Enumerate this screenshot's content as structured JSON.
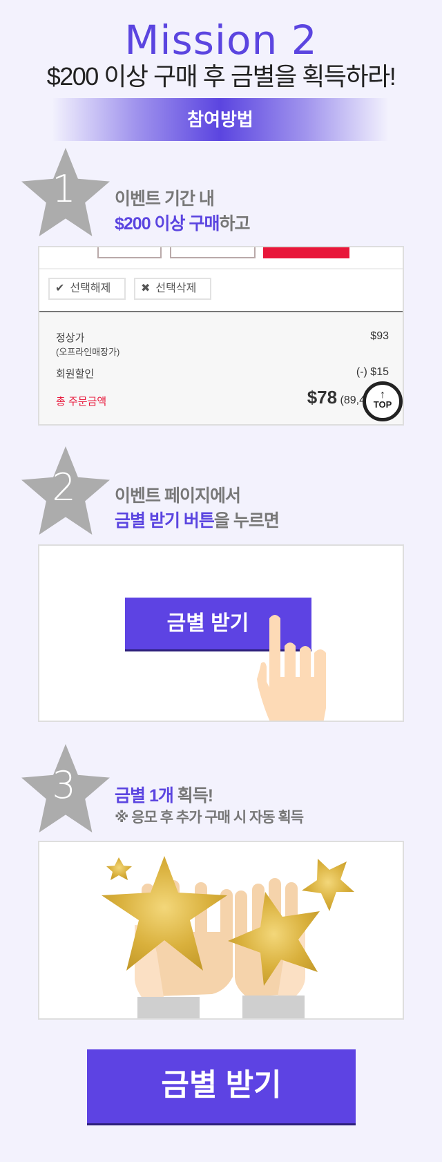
{
  "header": {
    "title": "Mission 2",
    "subtitle": "$200 이상 구매 후 금별을 획득하라!",
    "banner": "참여방법"
  },
  "steps": [
    {
      "number": "1",
      "line1": "이벤트 기간 내",
      "line2_highlight": "$200 이상 구매",
      "line2_rest": "하고"
    },
    {
      "number": "2",
      "line1": "이벤트 페이지에서",
      "line2_highlight": "금별 받기 버튼",
      "line2_rest": "을 누르면"
    },
    {
      "number": "3",
      "line1_highlight": "금별 1개",
      "line1_rest": " 획득!",
      "line2": "※ 응모 후 추가 구매 시 자동 획득"
    }
  ],
  "cart": {
    "deselect": "선택해제",
    "delete_selected": "선택삭제",
    "regular_price_label": "정상가",
    "regular_price_sub": "(오프라인매장가)",
    "regular_price": "$93",
    "member_discount_label": "회원할인",
    "member_discount": "(-) $15",
    "total_label": "총 주문금액",
    "total": "$78",
    "total_sub": "(89,4",
    "top_label": "TOP"
  },
  "demo_button": "금별 받기",
  "cta_button": "금별 받기",
  "colors": {
    "accent": "#5b45e0",
    "red": "#e8173a",
    "star_gray": "#acacac"
  }
}
